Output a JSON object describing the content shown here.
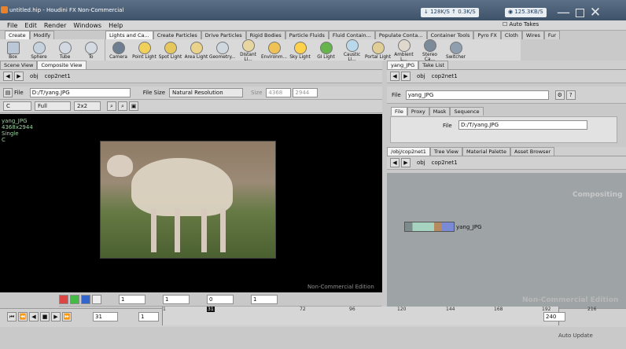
{
  "window": {
    "title": "untitled.hip - Houdini FX Non-Commercial",
    "download": "128K/S",
    "upload": "0.3K/S",
    "net": "125.3KB/S"
  },
  "menu": [
    "File",
    "Edit",
    "Render",
    "Windows",
    "Help"
  ],
  "shelf": {
    "left_tabs": [
      "Create",
      "Modify"
    ],
    "right_tabs": [
      "Lights and Ca...",
      "Create Particles",
      "Drive Particles",
      "Rigid Bodies",
      "Particle Fluids",
      "Fluid Contain...",
      "Populate Conta...",
      "Container Tools",
      "Pyro FX",
      "Cloth",
      "Wires",
      "Fur"
    ],
    "auto_takes": "Auto Takes",
    "left_tools": [
      "Box",
      "Sphere",
      "Tube",
      "To"
    ],
    "light_tools": [
      "Camera",
      "Point Light",
      "Spot Light",
      "Area Light",
      "Geometry...",
      "Distant Li...",
      "Environm...",
      "Sky Light",
      "GI Light",
      "Caustic Li...",
      "Portal Light",
      "Ambient L...",
      "Stereo Ca...",
      "Switcher"
    ]
  },
  "left_panes": {
    "tabs": [
      "Scene View",
      "Composite View"
    ],
    "path": [
      "obj",
      "cop2net1"
    ]
  },
  "viewer": {
    "file_label": "File",
    "file_value": "D:/T/yang.JPG",
    "file_size_label": "File Size",
    "file_size_value": "Natural Resolution",
    "size_label": "Size",
    "size_w": "4368",
    "size_h": "2944",
    "channel": "C",
    "quality": "Full",
    "zoom": "2x2",
    "name": "yang_JPG",
    "resolution": "4368x2944",
    "mode": "Single",
    "chan": "C",
    "watermark": "Non-Commercial Edition",
    "fields": [
      "1",
      "1",
      "0",
      "1"
    ]
  },
  "right_panes": {
    "tabs": [
      "yang_JPG",
      "Take List"
    ],
    "path": [
      "obj",
      "cop2net1"
    ],
    "node_name": "yang_JPG",
    "param_tabs": [
      "File",
      "Proxy",
      "Mask",
      "Sequence"
    ],
    "file_label": "File",
    "file_value": "D:/T/yang.JPG",
    "network_tabs": [
      "/obj/cop2net1",
      "Tree View",
      "Material Palette",
      "Asset Browser"
    ],
    "net_path": [
      "obj",
      "cop2net1"
    ],
    "context": "Compositing",
    "node": "yang_JPG",
    "watermark": "Non-Commercial Edition"
  },
  "timeline": {
    "current": "31",
    "start": "1",
    "end": "240",
    "labels": [
      "1",
      "31",
      "72",
      "96",
      "120",
      "144",
      "168",
      "192",
      "216"
    ],
    "auto_update": "Auto Update"
  }
}
